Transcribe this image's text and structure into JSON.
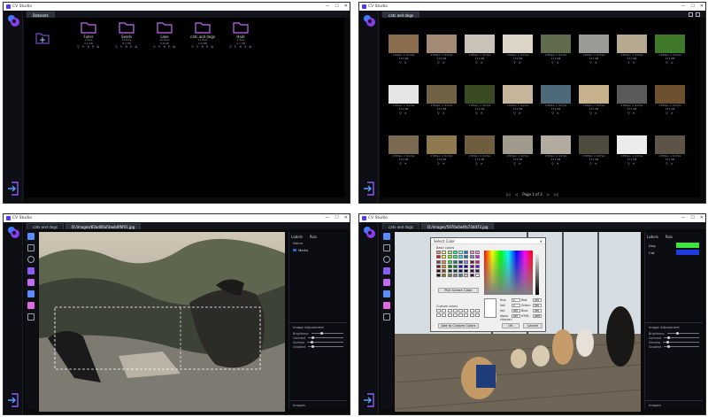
{
  "app": {
    "title": "CV Studio",
    "window_controls": [
      "—",
      "☐",
      "✕"
    ]
  },
  "datasets_view": {
    "tabs": [
      "Datasets"
    ],
    "folders": [
      {
        "name": "Fuller",
        "meta": [
          "1 files",
          "0.2 KB"
        ]
      },
      {
        "name": "Seeds",
        "meta": [
          "12 files",
          "8.3 KB"
        ]
      },
      {
        "name": "Lake",
        "meta": [
          "10 files",
          "0.8 KB"
        ]
      },
      {
        "name": "cats and dogs",
        "meta": [
          "12 files",
          "2.6 MB"
        ]
      },
      {
        "name": "Haiti",
        "meta": [
          "5 files",
          "2.1 KB"
        ]
      }
    ],
    "folder_actions": "⚲ ✎ ⟲ ⎘ ⧉"
  },
  "gallery_view": {
    "tabs": [
      "cats and dogs"
    ],
    "images": [
      {
        "size": "1705px × 917px",
        "filesize": "171 KB"
      },
      {
        "size": "1705px × 917px",
        "filesize": "171 KB"
      },
      {
        "size": "1705px × 917px",
        "filesize": "171 KB"
      },
      {
        "size": "1705px × 917px",
        "filesize": "171 KB"
      },
      {
        "size": "1705px × 917px",
        "filesize": "171 KB"
      },
      {
        "size": "1705px × 917px",
        "filesize": "171 KB"
      },
      {
        "size": "1705px × 917px",
        "filesize": "171 KB"
      },
      {
        "size": "1705px × 917px",
        "filesize": "171 KB"
      },
      {
        "size": "1705px × 917px",
        "filesize": "171 KB"
      },
      {
        "size": "1705px × 917px",
        "filesize": "171 KB"
      },
      {
        "size": "1705px × 917px",
        "filesize": "171 KB"
      },
      {
        "size": "1705px × 917px",
        "filesize": "171 KB"
      },
      {
        "size": "1705px × 917px",
        "filesize": "171 KB"
      },
      {
        "size": "1705px × 917px",
        "filesize": "171 KB"
      },
      {
        "size": "1705px × 917px",
        "filesize": "171 KB"
      },
      {
        "size": "1705px × 917px",
        "filesize": "171 KB"
      },
      {
        "size": "1705px × 917px",
        "filesize": "171 KB"
      },
      {
        "size": "1705px × 917px",
        "filesize": "171 KB"
      },
      {
        "size": "1705px × 917px",
        "filesize": "171 KB"
      },
      {
        "size": "1705px × 917px",
        "filesize": "171 KB"
      },
      {
        "size": "1705px × 917px",
        "filesize": "171 KB"
      },
      {
        "size": "1705px × 917px",
        "filesize": "171 KB"
      },
      {
        "size": "1705px × 917px",
        "filesize": "171 KB"
      },
      {
        "size": "1705px × 917px",
        "filesize": "171 KB"
      }
    ],
    "thumb_colors": [
      "#8a6d4f",
      "#a38a74",
      "#c9c2b8",
      "#dcd5c7",
      "#5f6b4a",
      "#9a9a96",
      "#b6a98f",
      "#3f7a2a",
      "#e6e6e6",
      "#6f6245",
      "#3a4a22",
      "#c4b59b",
      "#4c6a7a",
      "#c7b08c",
      "#5a5a5a",
      "#6d5030",
      "#7a6a52",
      "#8f7a50",
      "#6e5d3e",
      "#a09a8c",
      "#b2aca0",
      "#4d4b3e",
      "#ececec",
      "#5d5346"
    ],
    "thumb_actions": "⚲ ✕",
    "pager": {
      "prev": "◁",
      "first": "|◁",
      "page_text": "Page 1 of 3",
      "next": "▷",
      "last": "▷|"
    }
  },
  "editor_eagle": {
    "tabs": [
      "cats and dogs",
      "D:/images/83ad06af3aeb0f6f01.jpg"
    ],
    "panel_tabs": [
      "Labels",
      "Rois"
    ],
    "labels_header": "Name",
    "labels": [
      {
        "name": "Marks",
        "color": "#2f5fd6"
      }
    ],
    "adjust_title": "Image Adjustment",
    "adjust_rows": [
      "Brightness",
      "Contrast",
      "Gamma",
      "Gradient"
    ],
    "images_title": "Images"
  },
  "editor_dogs": {
    "tabs": [
      "cats and dogs",
      "D:/images/5976e0e4fa734d73.jpg"
    ],
    "panel_tabs": [
      "Labels",
      "Rois"
    ],
    "labels": [
      {
        "name": "Dog",
        "color": "#3fe23f"
      },
      {
        "name": "Cat",
        "color": "#1e3ce0"
      }
    ],
    "adjust_title": "Image Adjustment",
    "adjust_rows": [
      "Brightness",
      "Contrast",
      "Gamma",
      "Gradient"
    ],
    "images_title": "Images",
    "color_dialog": {
      "title": "Select Color",
      "basic_label": "Basic colors",
      "pick_button": "Pick Screen Color",
      "custom_label": "Custom colors",
      "add_button": "Add to Custom Colors",
      "fields": [
        {
          "label": "Hue:",
          "value": "0"
        },
        {
          "label": "Red:",
          "value": "255"
        },
        {
          "label": "Sat:",
          "value": "0"
        },
        {
          "label": "Green:",
          "value": "255"
        },
        {
          "label": "Val:",
          "value": "255"
        },
        {
          "label": "Blue:",
          "value": "255"
        },
        {
          "label": "Alpha channel:",
          "value": "255"
        },
        {
          "label": "HTML:",
          "value": "#ffffff"
        }
      ],
      "ok_button": "OK",
      "cancel_button": "Cancel",
      "basic_colors": [
        "#ff8080",
        "#ffff80",
        "#80ff80",
        "#00ff80",
        "#80ffff",
        "#0080ff",
        "#ff80c0",
        "#ff80ff",
        "#ff0000",
        "#ffff00",
        "#80ff00",
        "#00ff40",
        "#00ffff",
        "#0080c0",
        "#8080c0",
        "#ff00ff",
        "#804040",
        "#ff8040",
        "#00ff00",
        "#008080",
        "#004080",
        "#8080ff",
        "#800040",
        "#ff0080",
        "#800000",
        "#ff8000",
        "#008000",
        "#008040",
        "#0000ff",
        "#0000a0",
        "#800080",
        "#8000ff",
        "#400000",
        "#804000",
        "#004000",
        "#004040",
        "#000080",
        "#000040",
        "#400040",
        "#400080",
        "#000000",
        "#808000",
        "#808040",
        "#808080",
        "#408080",
        "#c0c0c0",
        "#400040",
        "#ffffff"
      ]
    }
  }
}
